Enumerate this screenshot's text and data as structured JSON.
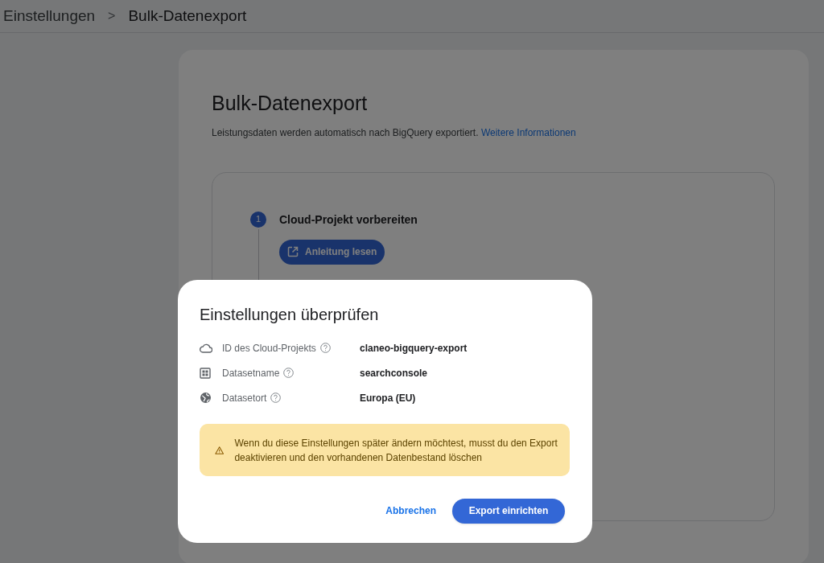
{
  "breadcrumb": {
    "parent": "Einstellungen",
    "separator": ">",
    "current": "Bulk-Datenexport"
  },
  "page": {
    "title": "Bulk-Datenexport",
    "description": "Leistungsdaten werden automatisch nach BigQuery exportiert.",
    "link": "Weitere Informationen",
    "steps": [
      {
        "number": "1",
        "title": "Cloud-Projekt vorbereiten",
        "button": "Anleitung lesen"
      }
    ]
  },
  "dialog": {
    "title": "Einstellungen überprüfen",
    "rows": [
      {
        "kind": "cloud",
        "label": "ID des Cloud-Projekts",
        "value": "claneo-bigquery-export"
      },
      {
        "kind": "grid",
        "label": "Datasetname",
        "value": "searchconsole"
      },
      {
        "kind": "globe",
        "label": "Datasetort",
        "value": "Europa (EU)"
      }
    ],
    "warning": "Wenn du diese Einstellungen später ändern möchtest, musst du den Export deaktivieren und den vorhandenen Datenbestand löschen",
    "cancel": "Abbrechen",
    "confirm": "Export einrichten"
  }
}
